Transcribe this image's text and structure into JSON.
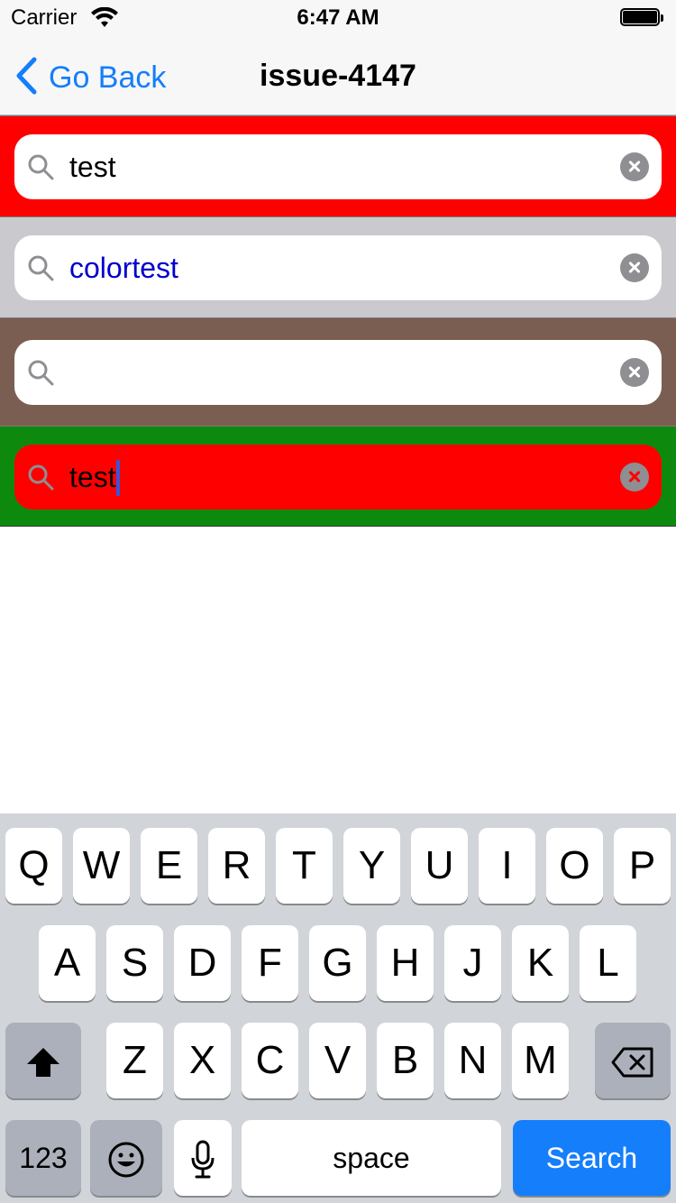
{
  "status_bar": {
    "carrier": "Carrier",
    "time": "6:47 AM"
  },
  "nav": {
    "back_label": "Go Back",
    "title": "issue-4147"
  },
  "search_rows": [
    {
      "bar_color": "#ff0000",
      "field_color": "#ffffff",
      "text": "test",
      "text_color": "#000000",
      "clear_icon": "clear-icon"
    },
    {
      "bar_color": "#c9c9ce",
      "field_color": "#ffffff",
      "text": "colortest",
      "text_color": "#0000cc",
      "clear_icon": "clear-icon"
    },
    {
      "bar_color": "#7b5e52",
      "field_color": "#ffffff",
      "text": "",
      "text_color": "#000000",
      "clear_icon": "clear-icon"
    },
    {
      "bar_color": "#0d8a0d",
      "field_color": "#ff0000",
      "text": "test",
      "text_color": "#000000",
      "clear_icon": "clear-icon",
      "focused": true
    }
  ],
  "keyboard": {
    "row1": [
      "Q",
      "W",
      "E",
      "R",
      "T",
      "Y",
      "U",
      "I",
      "O",
      "P"
    ],
    "row2": [
      "A",
      "S",
      "D",
      "F",
      "G",
      "H",
      "J",
      "K",
      "L"
    ],
    "row3": [
      "Z",
      "X",
      "C",
      "V",
      "B",
      "N",
      "M"
    ],
    "numbers_label": "123",
    "space_label": "space",
    "return_label": "Search",
    "icons": [
      "shift-icon",
      "backspace-icon",
      "emoji-icon",
      "microphone-icon"
    ]
  },
  "colors": {
    "accent": "#147efb",
    "keyboard_bg": "#d1d4d9",
    "dark_key": "#abb0ba"
  }
}
